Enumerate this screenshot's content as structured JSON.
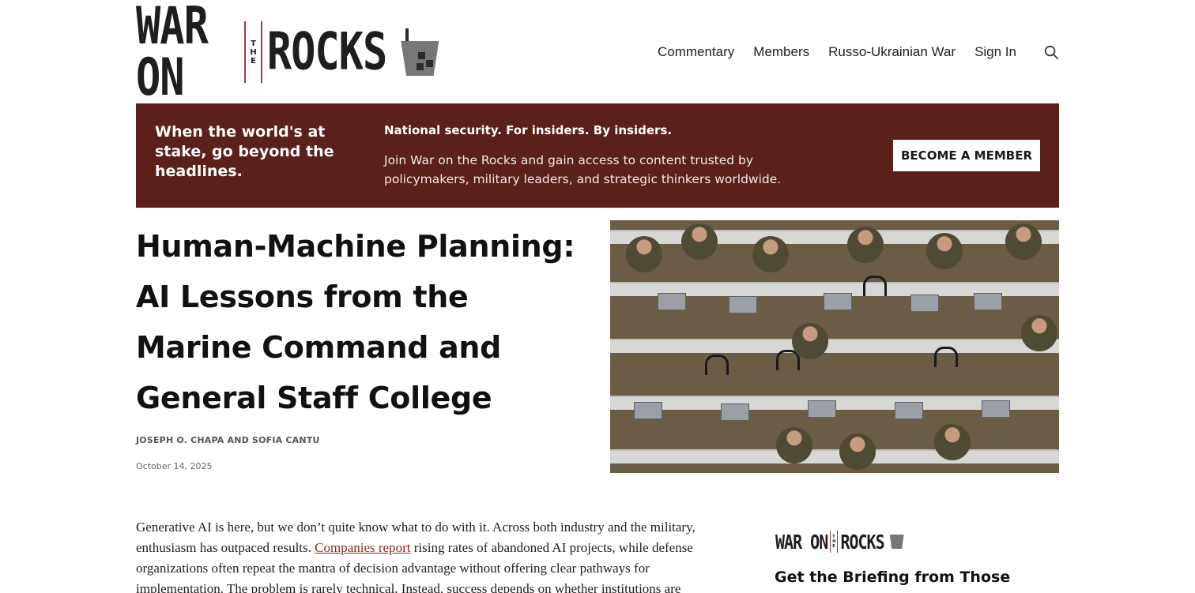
{
  "site": {
    "logo_word_left": "WAR ON",
    "logo_the": [
      "T",
      "H",
      "E"
    ],
    "logo_word_right": "ROCKS"
  },
  "nav": {
    "items": [
      "Commentary",
      "Members",
      "Russo-Ukrainian War",
      "Sign In"
    ],
    "search_icon": "search-icon"
  },
  "banner": {
    "tagline": "When the world's at stake, go beyond the headlines.",
    "title": "National security. For insiders. By insiders.",
    "body": "Join War on the Rocks and gain access to content trusted by policymakers, military leaders, and strategic thinkers worldwide.",
    "cta": "BECOME A MEMBER",
    "bg_color": "#5a2019"
  },
  "article": {
    "headline": "Human-Machine Planning: AI Lessons from the Marine Command and General Staff College",
    "authors": "JOSEPH O. CHAPA AND SOFIA CANTU",
    "date": "October 14, 2025",
    "body_start": "Generative AI is here, but we don’t quite know what to do with it. Across both industry and the military, enthusiasm has outpaced results. ",
    "link_text": "Companies report",
    "body_after_link": " rising rates of abandoned AI projects, while defense organizations often repeat the mantra of decision advantage without offering clear pathways for implementation. The problem is rarely technical. Instead, success depends on whether institutions are"
  },
  "sidebar": {
    "heading": "Get the Briefing from Those"
  },
  "colors": {
    "accent": "#8a2d25",
    "logo_rule": "#a33a3a"
  }
}
